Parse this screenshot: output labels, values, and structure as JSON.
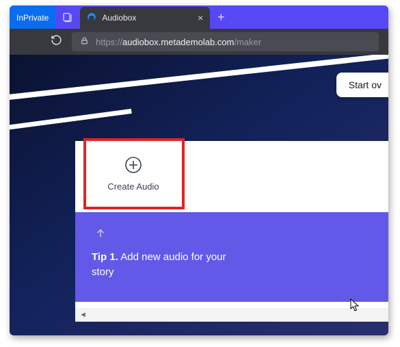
{
  "browser": {
    "inprivate_label": "InPrivate",
    "tab_title": "Audiobox",
    "url_scheme": "https://",
    "url_host": "audiobox.metademolab.com",
    "url_path": "/maker"
  },
  "header": {
    "start_over_label": "Start ov"
  },
  "create": {
    "label": "Create Audio"
  },
  "tip": {
    "bold": "Tip 1.",
    "rest": " Add new audio for your story"
  }
}
